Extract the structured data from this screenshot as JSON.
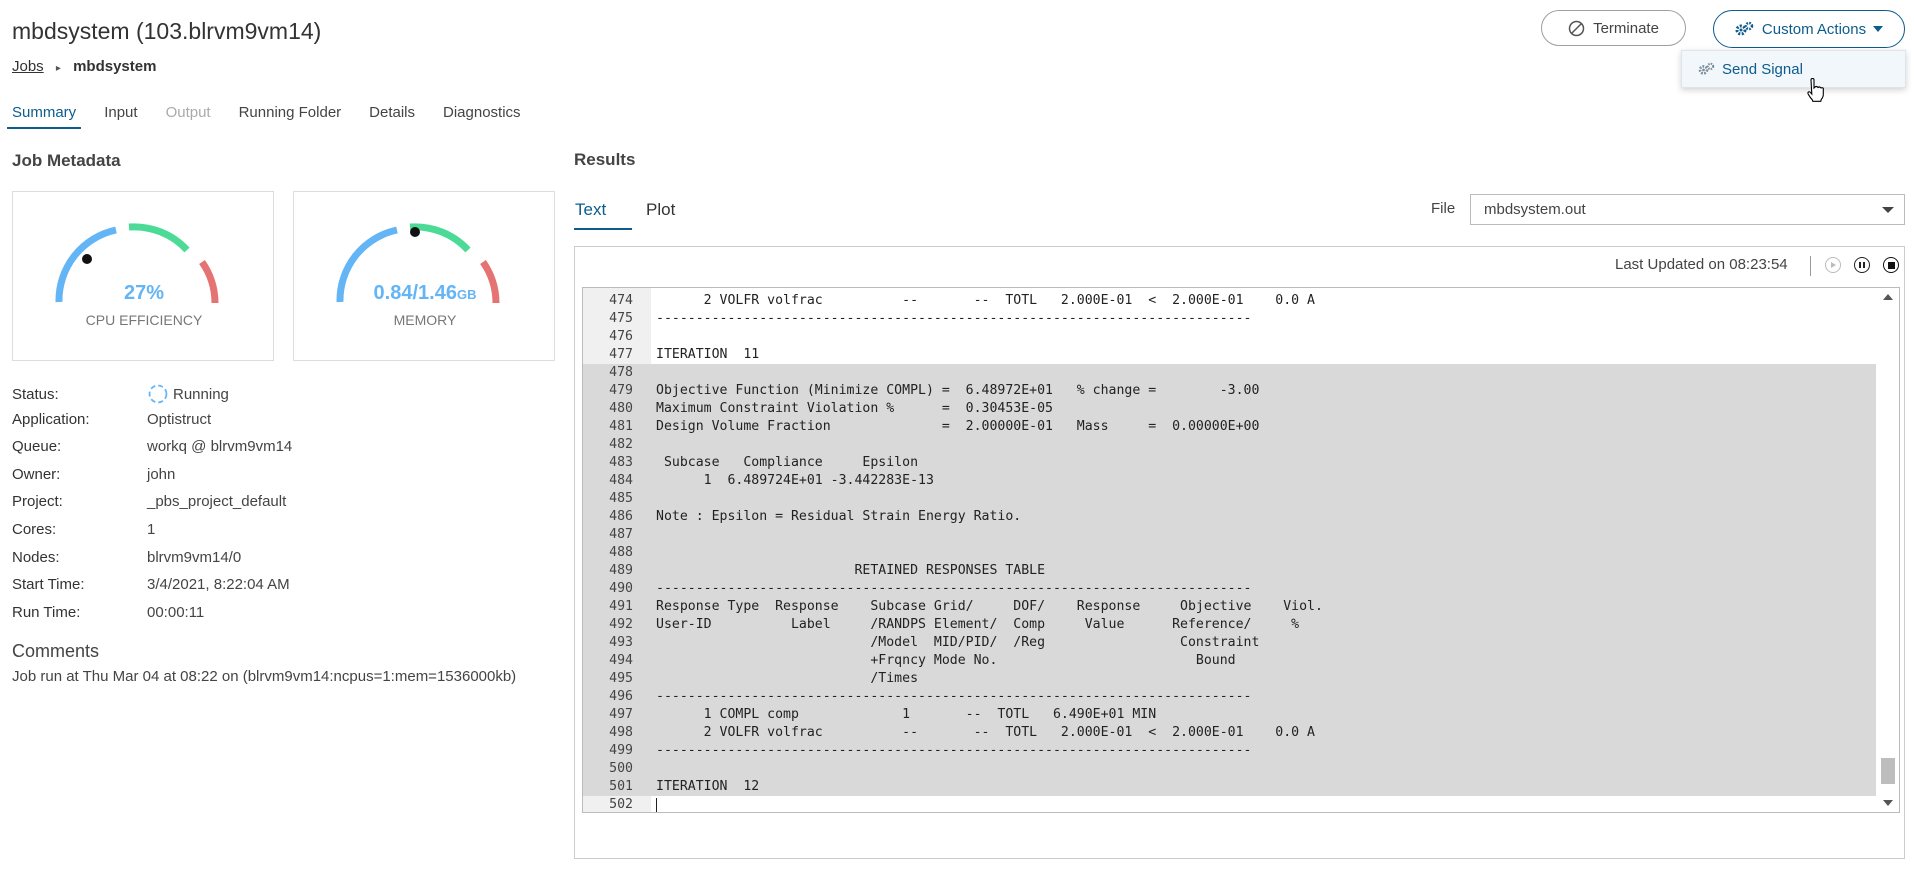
{
  "header": {
    "title": "mbdsystem (103.blrvm9vm14)",
    "breadcrumb": {
      "link": "Jobs",
      "current": "mbdsystem"
    },
    "terminate_label": "Terminate",
    "custom_actions_label": "Custom Actions",
    "dropdown_item": "Send Signal"
  },
  "tabs": [
    {
      "label": "Summary",
      "state": "active"
    },
    {
      "label": "Input",
      "state": "normal"
    },
    {
      "label": "Output",
      "state": "disabled"
    },
    {
      "label": "Running Folder",
      "state": "normal"
    },
    {
      "label": "Details",
      "state": "normal"
    },
    {
      "label": "Diagnostics",
      "state": "normal"
    }
  ],
  "metadata": {
    "title": "Job Metadata",
    "cpu": {
      "value": "27%",
      "label": "CPU EFFICIENCY",
      "level": 0.27
    },
    "memory": {
      "value": "0.84/1.46",
      "unit": "GB",
      "label": "MEMORY",
      "level": 0.575
    },
    "rows": [
      {
        "key": "Status:",
        "value": "Running"
      },
      {
        "key": "Application:",
        "value": "Optistruct"
      },
      {
        "key": "Queue:",
        "value": "workq @ blrvm9vm14"
      },
      {
        "key": "Owner:",
        "value": "john"
      },
      {
        "key": "Project:",
        "value": "_pbs_project_default"
      },
      {
        "key": "Cores:",
        "value": "1"
      },
      {
        "key": "Nodes:",
        "value": "blrvm9vm14/0"
      },
      {
        "key": "Start Time:",
        "value": "3/4/2021, 8:22:04 AM"
      },
      {
        "key": "Run Time:",
        "value": "00:00:11"
      }
    ],
    "comments_title": "Comments",
    "comments_text": "Job run at Thu Mar 04 at 08:22 on (blrvm9vm14:ncpus=1:mem=1536000kb)"
  },
  "results": {
    "title": "Results",
    "tabs": [
      "Text",
      "Plot"
    ],
    "active_tab": "Text",
    "file_label": "File",
    "file_value": "mbdsystem.out",
    "last_updated": "Last Updated on 08:23:54",
    "lines": [
      {
        "n": "474",
        "t": "      2 VOLFR volfrac          --       --  TOTL   2.000E-01  <  2.000E-01    0.0 A"
      },
      {
        "n": "475",
        "t": "---------------------------------------------------------------------------"
      },
      {
        "n": "476",
        "t": ""
      },
      {
        "n": "477",
        "t": "ITERATION  11"
      },
      {
        "n": "478",
        "t": ""
      },
      {
        "n": "479",
        "t": "Objective Function (Minimize COMPL) =  6.48972E+01   % change =        -3.00"
      },
      {
        "n": "480",
        "t": "Maximum Constraint Violation %      =  0.30453E-05"
      },
      {
        "n": "481",
        "t": "Design Volume Fraction              =  2.00000E-01   Mass     =  0.00000E+00"
      },
      {
        "n": "482",
        "t": ""
      },
      {
        "n": "483",
        "t": " Subcase   Compliance     Epsilon"
      },
      {
        "n": "484",
        "t": "      1  6.489724E+01 -3.442283E-13"
      },
      {
        "n": "485",
        "t": ""
      },
      {
        "n": "486",
        "t": "Note : Epsilon = Residual Strain Energy Ratio."
      },
      {
        "n": "487",
        "t": ""
      },
      {
        "n": "488",
        "t": ""
      },
      {
        "n": "489",
        "t": "                         RETAINED RESPONSES TABLE"
      },
      {
        "n": "490",
        "t": "---------------------------------------------------------------------------"
      },
      {
        "n": "491",
        "t": "Response Type  Response    Subcase Grid/     DOF/    Response     Objective    Viol."
      },
      {
        "n": "492",
        "t": "User-ID          Label     /RANDPS Element/  Comp     Value      Reference/     %"
      },
      {
        "n": "493",
        "t": "                           /Model  MID/PID/  /Reg                 Constraint"
      },
      {
        "n": "494",
        "t": "                           +Frqncy Mode No.                         Bound"
      },
      {
        "n": "495",
        "t": "                           /Times"
      },
      {
        "n": "496",
        "t": "---------------------------------------------------------------------------"
      },
      {
        "n": "497",
        "t": "      1 COMPL comp             1       --  TOTL   6.490E+01 MIN"
      },
      {
        "n": "498",
        "t": "      2 VOLFR volfrac          --       --  TOTL   2.000E-01  <  2.000E-01    0.0 A"
      },
      {
        "n": "499",
        "t": "---------------------------------------------------------------------------"
      },
      {
        "n": "500",
        "t": ""
      },
      {
        "n": "501",
        "t": "ITERATION  12"
      },
      {
        "n": "502",
        "t": ""
      }
    ]
  },
  "colors": {
    "accent": "#0d5c8c",
    "gauge_blue": "#64b5f6",
    "gauge_green": "#4cdb96",
    "gauge_red": "#e57373",
    "selection": "#d9d9d9"
  }
}
